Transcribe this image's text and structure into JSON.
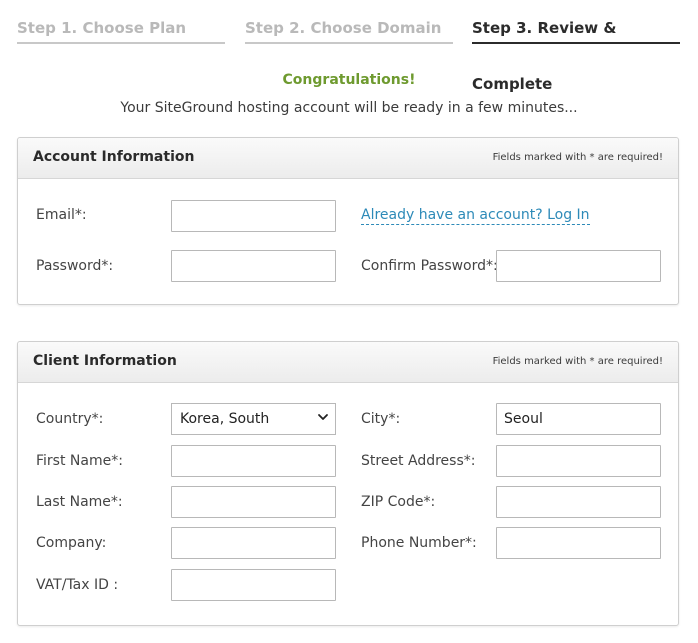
{
  "steps": [
    {
      "label": "Step 1. Choose Plan",
      "active": false
    },
    {
      "label": "Step 2. Choose Domain",
      "active": false
    },
    {
      "label": "Step 3. Review & Complete",
      "active": true
    }
  ],
  "congrats": {
    "title": "Congratulations!",
    "subtitle": "Your SiteGround hosting account will be ready in a few minutes..."
  },
  "account": {
    "title": "Account Information",
    "note": "Fields marked with * are required!",
    "email_label": "Email*:",
    "email_value": "",
    "login_link": "Already have an account? Log In",
    "password_label": "Password*:",
    "password_value": "",
    "confirm_label": "Confirm Password*:",
    "confirm_value": ""
  },
  "client": {
    "title": "Client Information",
    "note": "Fields marked with * are required!",
    "country_label": "Country*:",
    "country_value": "Korea, South",
    "city_label": "City*:",
    "city_value": "Seoul",
    "first_name_label": "First Name*:",
    "first_name_value": "",
    "street_label": "Street Address*:",
    "street_value": "",
    "last_name_label": "Last Name*:",
    "last_name_value": "",
    "zip_label": "ZIP Code*:",
    "zip_value": "",
    "company_label": "Company:",
    "company_value": "",
    "phone_label": "Phone Number*:",
    "phone_value": "",
    "vat_label": "VAT/Tax ID :",
    "vat_value": ""
  },
  "colors": {
    "accent_green": "#6e9a2f",
    "link_blue": "#2d8ab8",
    "active_step": "#2b2b2b",
    "inactive_step": "#b9b9b9"
  }
}
